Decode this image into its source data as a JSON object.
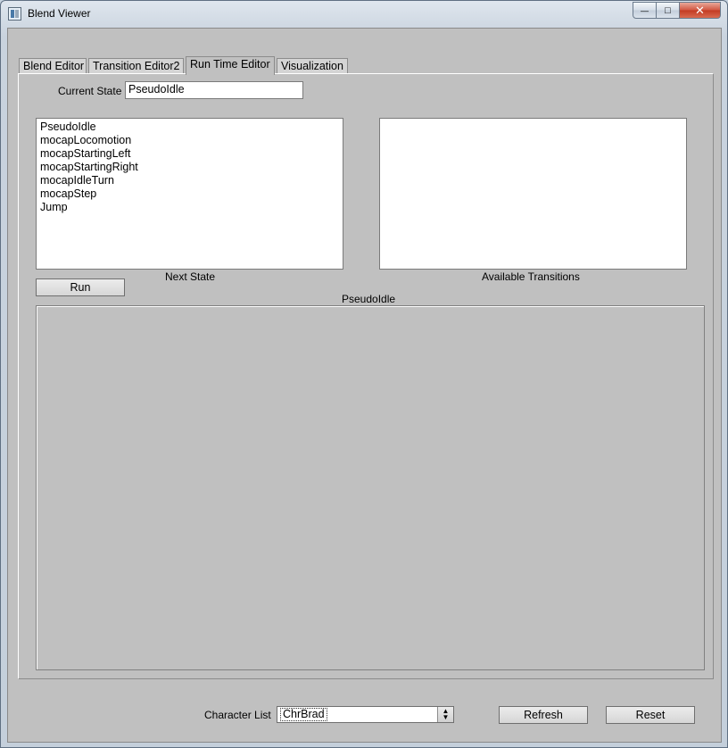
{
  "window": {
    "title": "Blend Viewer",
    "minimize_glyph": "—",
    "maximize_glyph": "□",
    "close_glyph": "✕"
  },
  "tabs": [
    {
      "label": "Blend Editor",
      "active": false
    },
    {
      "label": "Transition Editor2",
      "active": false
    },
    {
      "label": "Run Time Editor",
      "active": true
    },
    {
      "label": "Visualization",
      "active": false
    }
  ],
  "runtime": {
    "current_state_label": "Current State",
    "current_state_value": "PseudoIdle",
    "next_state_items": [
      "PseudoIdle",
      "mocapLocomotion",
      "mocapStartingLeft",
      "mocapStartingRight",
      "mocapIdleTurn",
      "mocapStep",
      "Jump"
    ],
    "available_transitions_items": [],
    "next_state_label": "Next State",
    "available_transitions_label": "Available Transitions",
    "run_label": "Run",
    "viewport_title": "PseudoIdle"
  },
  "footer": {
    "character_list_label": "Character List",
    "character_selected": "ChrBrad",
    "refresh_label": "Refresh",
    "reset_label": "Reset"
  }
}
